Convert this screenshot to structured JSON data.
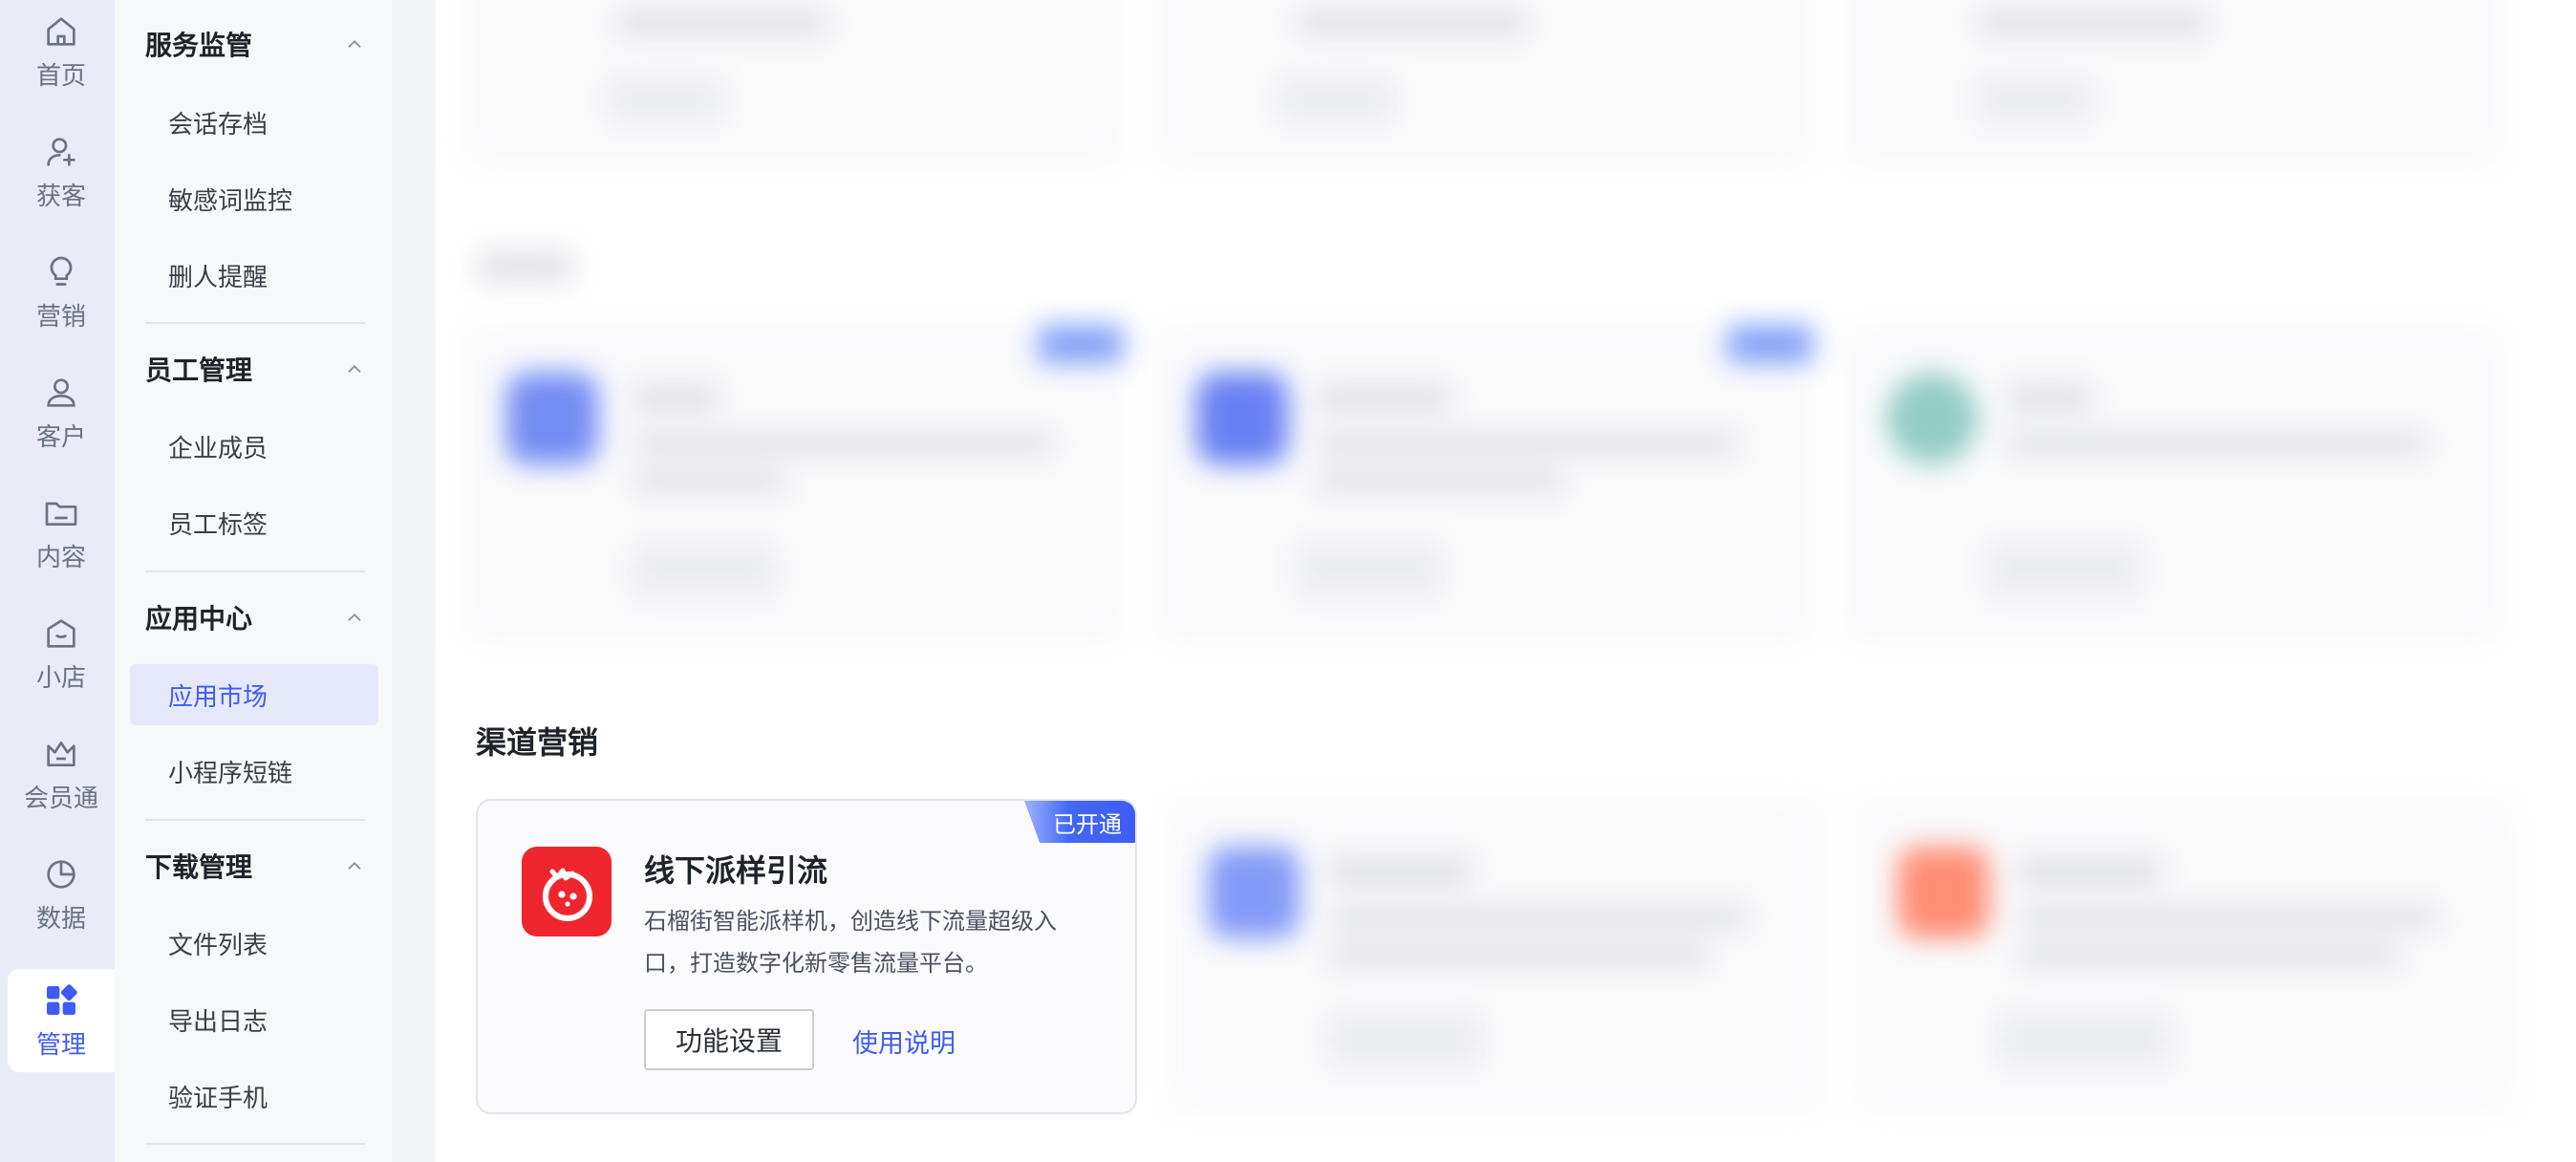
{
  "rail": {
    "items": [
      {
        "label": "首页",
        "icon": "home-icon"
      },
      {
        "label": "获客",
        "icon": "user-add-icon"
      },
      {
        "label": "营销",
        "icon": "bulb-icon"
      },
      {
        "label": "客户",
        "icon": "user-icon"
      },
      {
        "label": "内容",
        "icon": "folder-icon"
      },
      {
        "label": "小店",
        "icon": "shop-icon"
      },
      {
        "label": "会员通",
        "icon": "crown-icon"
      },
      {
        "label": "数据",
        "icon": "pie-chart-icon"
      },
      {
        "label": "管理",
        "icon": "grid-icon"
      }
    ],
    "active_index": 8
  },
  "menu": {
    "groups": [
      {
        "title": "服务监管",
        "items": [
          "会话存档",
          "敏感词监控",
          "删人提醒"
        ]
      },
      {
        "title": "员工管理",
        "items": [
          "企业成员",
          "员工标签"
        ]
      },
      {
        "title": "应用中心",
        "items": [
          "应用市场",
          "小程序短链"
        ]
      },
      {
        "title": "下载管理",
        "items": [
          "文件列表",
          "导出日志",
          "验证手机"
        ]
      }
    ],
    "active_item": "应用市场"
  },
  "main": {
    "section_channel": "渠道营销",
    "focus_card": {
      "badge": "已开通",
      "title": "线下派样引流",
      "desc_line1": "石榴街智能派样机，创造线下流量超级入",
      "desc_line2": "口，打造数字化新零售流量平台。",
      "settings_label": "功能设置",
      "help_label": "使用说明"
    }
  },
  "colors": {
    "accent": "#3e5cf4",
    "focus_icon_bg": "#f0262f"
  }
}
